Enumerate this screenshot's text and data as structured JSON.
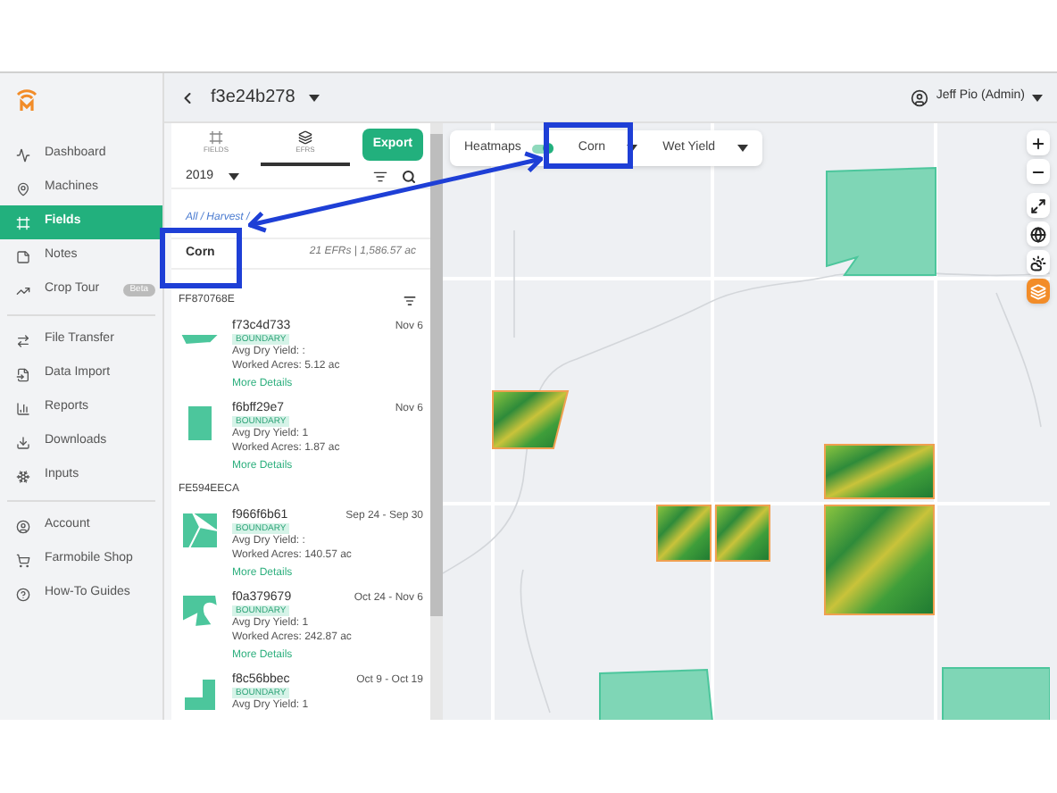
{
  "header": {
    "title": "f3e24b278",
    "user": "Jeff Pio (Admin)"
  },
  "sidebar": {
    "groups": [
      [
        {
          "label": "Dashboard",
          "selected": false
        },
        {
          "label": "Machines",
          "selected": false
        },
        {
          "label": "Fields",
          "selected": true
        },
        {
          "label": "Notes",
          "selected": false
        },
        {
          "label": "Crop Tour",
          "selected": false,
          "badge": "Beta"
        }
      ],
      [
        {
          "label": "File Transfer",
          "selected": false
        },
        {
          "label": "Data Import",
          "selected": false
        },
        {
          "label": "Reports",
          "selected": false
        },
        {
          "label": "Downloads",
          "selected": false
        },
        {
          "label": "Inputs",
          "selected": false
        }
      ],
      [
        {
          "label": "Account",
          "selected": false
        },
        {
          "label": "Farmobile Shop",
          "selected": false
        },
        {
          "label": "How-To Guides",
          "selected": false
        }
      ]
    ]
  },
  "panel": {
    "tabs": [
      {
        "label": "FIELDS",
        "selected": false
      },
      {
        "label": "EFRS",
        "selected": true
      }
    ],
    "export_button": "Export",
    "year": "2019",
    "breadcrumb": "All / Harvest /",
    "crop": "Corn",
    "summary": "21 EFRs | 1,586.57 ac",
    "groups": [
      {
        "name": "FF870768E",
        "records": [
          {
            "id": "f73c4d733",
            "tag": "BOUNDARY",
            "date": "Nov 6",
            "yield": "Avg Dry Yield: :",
            "acres": "Worked Acres: 5.12 ac",
            "link": "More Details"
          },
          {
            "id": "f6bff29e7",
            "tag": "BOUNDARY",
            "date": "Nov 6",
            "yield": "Avg Dry Yield: 1",
            "acres": "Worked Acres: 1.87 ac",
            "link": "More Details"
          }
        ]
      },
      {
        "name": "FE594EECA",
        "records": [
          {
            "id": "f966f6b61",
            "tag": "BOUNDARY",
            "date": "Sep 24 - Sep 30",
            "yield": "Avg Dry Yield: :",
            "acres": "Worked Acres: 140.57 ac",
            "link": "More Details"
          },
          {
            "id": "f0a379679",
            "tag": "BOUNDARY",
            "date": "Oct 24 - Nov 6",
            "yield": "Avg Dry Yield: 1",
            "acres": "Worked Acres: 242.87 ac",
            "link": "More Details"
          },
          {
            "id": "f8c56bbec",
            "tag": "BOUNDARY",
            "date": "Oct 9 - Oct 19",
            "yield": "Avg Dry Yield: 1"
          }
        ]
      }
    ]
  },
  "map": {
    "heatmaps": {
      "label": "Heatmaps",
      "on": true
    },
    "crop_select": "Corn",
    "layer_select": "Wet Yield",
    "controls": [
      {
        "selected": false
      },
      {
        "selected": false
      },
      {
        "selected": false
      },
      {
        "selected": false
      },
      {
        "selected": false
      },
      {
        "selected": true
      }
    ]
  }
}
